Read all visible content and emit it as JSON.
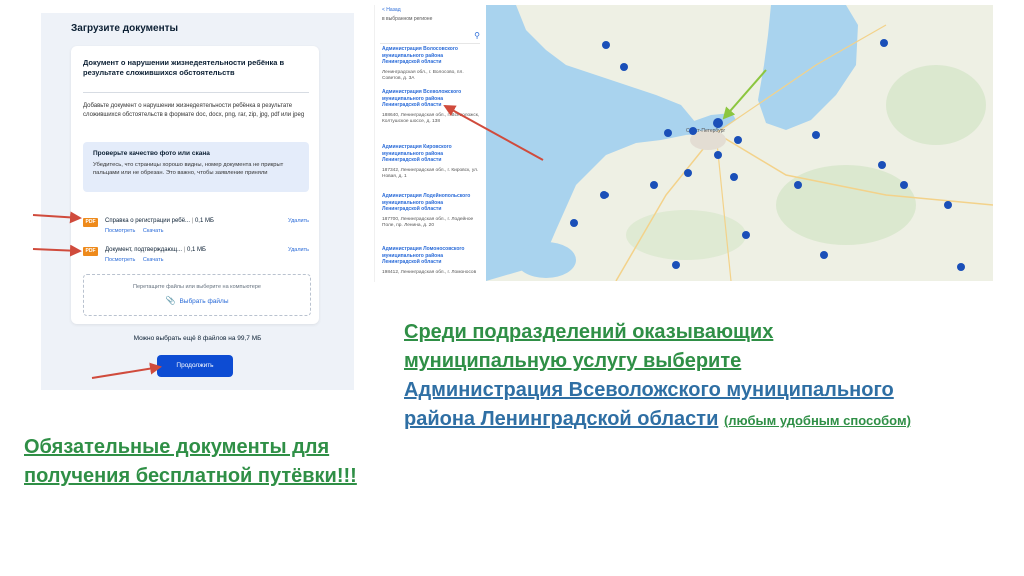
{
  "upload": {
    "title": "Загрузите документы",
    "card_heading": "Документ о нарушении жизнедеятельности ребёнка в результате сложившихся обстоятельств",
    "description": "Добавьте документ о нарушении жизнедеятельности ребёнка в результате сложившихся обстоятельств в формате doc, docx, png, rar, zip, jpg, pdf или jpeg",
    "info_title": "Проверьте качество фото или скана",
    "info_text": "Убедитесь, что страницы хорошо видны, номер документа не прикрыт пальцами или не обрезан. Это важно, чтобы заявление приняли",
    "files": [
      {
        "badge": "PDF",
        "name": "Справка о регистрации ребё...",
        "size": "0,1 МБ",
        "view": "Посмотреть",
        "download": "Скачать",
        "delete": "Удалить"
      },
      {
        "badge": "PDF",
        "name": "Документ, подтверждающ...",
        "size": "0,1 МБ",
        "view": "Посмотреть",
        "download": "Скачать",
        "delete": "Удалить"
      }
    ],
    "dropzone_hint": "Перетащите файлы или выберите на компьютере",
    "choose_files": "Выбрать файлы",
    "limit": "Можно выбрать ещё 8 файлов на 99,7 МБ",
    "continue_label": "Продолжить"
  },
  "list": {
    "back": "< Назад",
    "subtitle": "в выбранном регионе",
    "entries": [
      {
        "name": "Администрация Волосовского муниципального района Ленинградской области",
        "address": "Ленинградская обл., г. Волосово, пл. Советов, д. 3А"
      },
      {
        "name": "Администрация Всеволожского муниципального района Ленинградской области",
        "address": "188640, Ленинградская обл., г. Всеволожск, Колтушское шоссе, д. 138"
      },
      {
        "name": "Администрация Кировского муниципального района Ленинградской области",
        "address": "187342, Ленинградская обл., г. Кировск, ул. Новая, д. 1"
      },
      {
        "name": "Администрация Лодейнопольского муниципального района Ленинградской области",
        "address": "187700, Ленинградская обл., г. Лодейное Поле, пр. Ленина, д. 20"
      },
      {
        "name": "Администрация Ломоносовского муниципального района Ленинградской области",
        "address": "198412, Ленинградская обл., г. Ломоносов"
      }
    ]
  },
  "map": {
    "city_label": "Санкт-Петербург",
    "colors": {
      "water": "#a9d3ee",
      "land": "#eef0e4",
      "pin": "#1a4fb8",
      "forest": "#cfe3c2"
    }
  },
  "captions": {
    "right_line1": "Среди подразделений оказывающих",
    "right_line2": "муниципальную услугу выберите",
    "right_line3": "Администрация Всеволожского муниципального",
    "right_line4": "района Ленинградской области",
    "right_note": "(любым удобным способом)",
    "left_line1": "Обязательные документы для",
    "left_line2": "получения бесплатной путёвки!!!"
  }
}
